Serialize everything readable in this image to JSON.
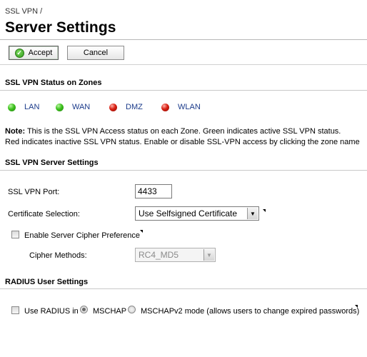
{
  "breadcrumb": "SSL VPN /",
  "page_title": "Server Settings",
  "toolbar": {
    "accept_label": "Accept",
    "cancel_label": "Cancel"
  },
  "status_section": {
    "title": "SSL VPN Status on Zones",
    "zones": [
      {
        "name": "LAN",
        "status": "active",
        "color": "#3ec21e"
      },
      {
        "name": "WAN",
        "status": "active",
        "color": "#3ec21e"
      },
      {
        "name": "DMZ",
        "status": "inactive",
        "color": "#d81f12"
      },
      {
        "name": "WLAN",
        "status": "inactive",
        "color": "#d81f12"
      }
    ],
    "note_label": "Note:",
    "note_line1": " This is the SSL VPN Access status on each Zone. Green indicates active SSL VPN status.",
    "note_line2": "Red indicates inactive SSL VPN status. Enable or disable SSL-VPN access by clicking the zone name"
  },
  "server_section": {
    "title": "SSL VPN Server Settings",
    "port_label": "SSL VPN Port:",
    "port_value": "4433",
    "cert_label": "Certificate Selection:",
    "cert_value": "Use Selfsigned Certificate",
    "cipher_pref_label": "Enable Server Cipher Preference",
    "cipher_pref_checked": false,
    "cipher_methods_label": "Cipher Methods:",
    "cipher_methods_value": "RC4_MD5"
  },
  "radius_section": {
    "title": "RADIUS User Settings",
    "use_radius_label": "Use RADIUS in",
    "use_radius_checked": false,
    "mschap_label": "MSCHAP",
    "mschapv2_label": "MSCHAPv2 mode (allows users to change expired passwords)",
    "selected_mode": "MSCHAP"
  }
}
